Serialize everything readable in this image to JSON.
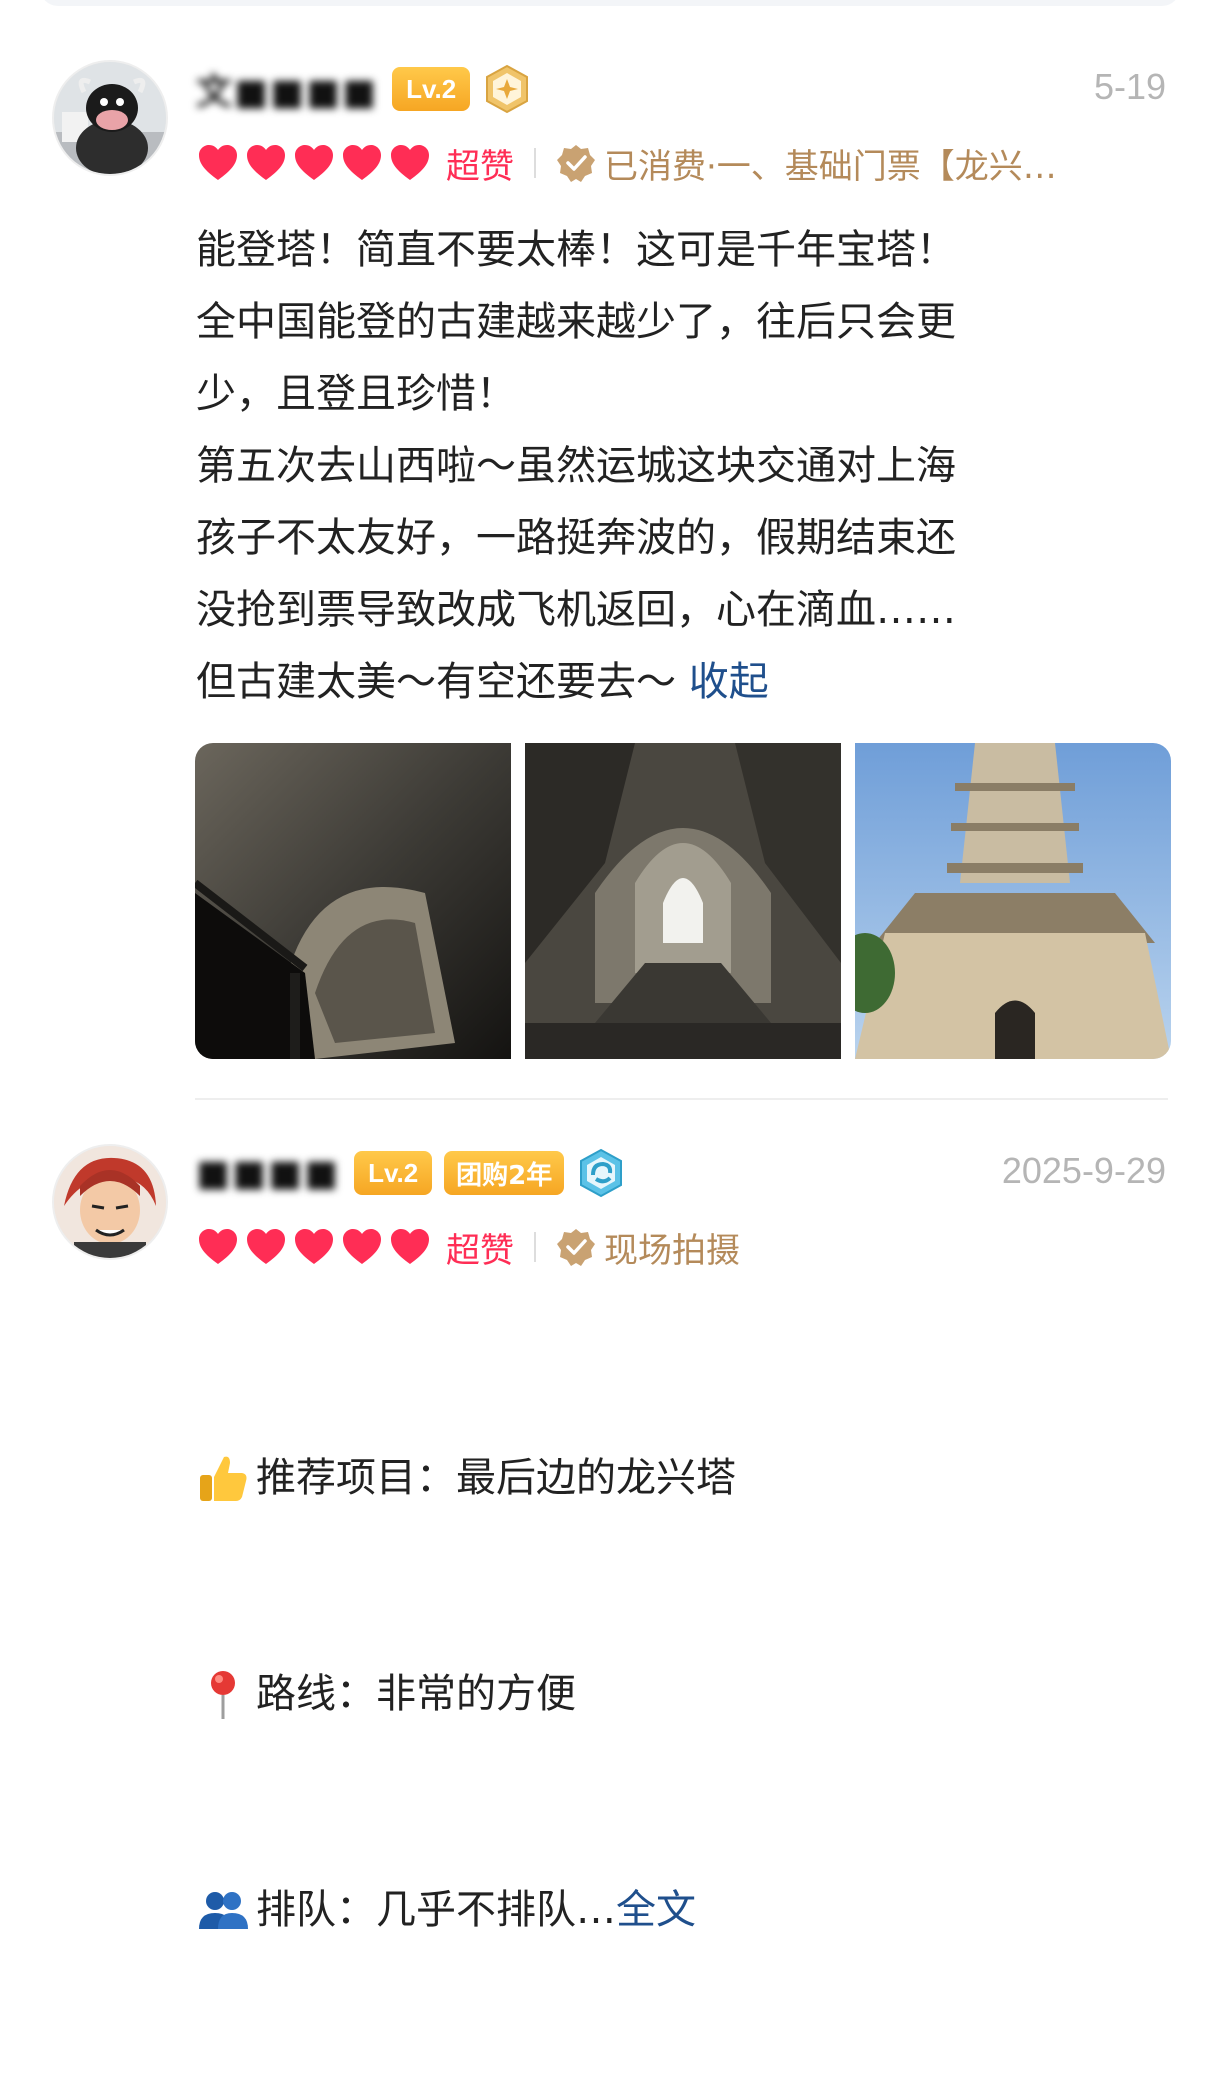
{
  "reviews": [
    {
      "user_name": "文■■■■",
      "level": "Lv.2",
      "date": "5-19",
      "rating_label": "超赞",
      "verify_label": "已消费·一、基础门票【龙兴…",
      "body": "能登塔！简直不要太棒！这可是千年宝塔！\n全中国能登的古建越来越少了，往后只会更\n少，且登且珍惜！\n第五次去山西啦～虽然运城这块交通对上海\n孩子不太友好，一路挺奔波的，假期结束还\n没抢到票导致改成飞机返回，心在滴血……\n但古建太美～有空还要去～ ",
      "collapse_label": "收起"
    },
    {
      "user_name": "■■■■",
      "level": "Lv.2",
      "tuan_badge": "团购2年",
      "date": "2025-9-29",
      "rating_label": "超赞",
      "verify_label": "现场拍摄",
      "lines": [
        {
          "icon": "thumbs-up",
          "text": "推荐项目：最后边的龙兴塔"
        },
        {
          "icon": "pin",
          "text": "路线：非常的方便"
        },
        {
          "icon": "people",
          "text": "排队：几乎不排队…"
        }
      ],
      "more_label": "全文"
    }
  ],
  "colors": {
    "heart": "#ff2d55",
    "verify": "#b48a5a",
    "link": "#1f4f8c",
    "date": "#b5b5b5"
  }
}
